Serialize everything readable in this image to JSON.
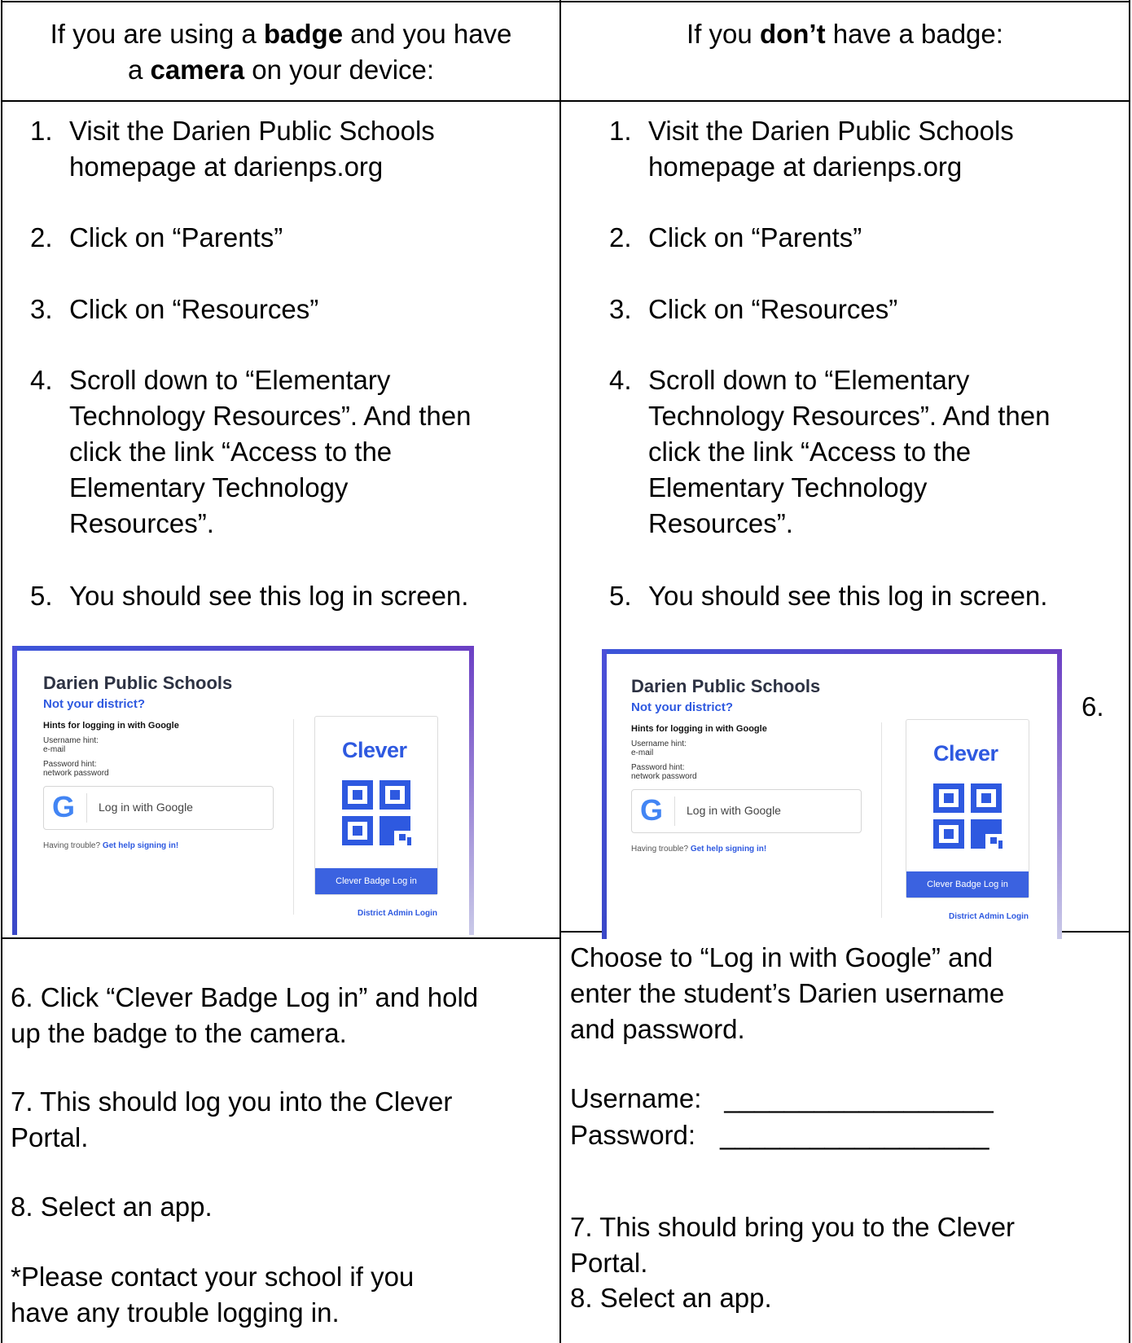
{
  "header": {
    "left": {
      "pre": "If you are using a ",
      "b1": "badge",
      "mid": " and you have",
      "line2_pre": "a ",
      "b2": "camera",
      "line2_post": " on your device:"
    },
    "right": {
      "pre": "If you ",
      "b1": "don’t",
      "post": " have a badge:"
    }
  },
  "left_steps": [
    {
      "num": "1.",
      "lines": [
        " Visit the Darien Public Schools",
        "homepage at darienps.org"
      ]
    },
    {
      "num": "2.",
      "lines": [
        "Click on “Parents”"
      ]
    },
    {
      "num": "3.",
      "lines": [
        "Click on  “Resources”"
      ]
    },
    {
      "num": "4.",
      "lines": [
        "Scroll down to “Elementary",
        "Technology Resources”.  And then",
        "click the link “Access to the",
        "Elementary Technology",
        "Resources”."
      ]
    },
    {
      "num": "5.",
      "lines": [
        "You should see this log in screen."
      ]
    }
  ],
  "right_steps": [
    {
      "num": "1.",
      "lines": [
        "Visit the Darien Public Schools",
        "homepage at darienps.org"
      ]
    },
    {
      "num": "2.",
      "lines": [
        "Click on “Parents”"
      ]
    },
    {
      "num": "3.",
      "lines": [
        "Click on  “Resources”"
      ]
    },
    {
      "num": "4.",
      "lines": [
        "Scroll down to “Elementary",
        "Technology Resources”.  And then",
        "click the link “Access to the",
        "Elementary Technology",
        "Resources”."
      ]
    },
    {
      "num": "5.",
      "lines": [
        "You should see this log in screen."
      ]
    }
  ],
  "login_screen": {
    "district": "Darien Public Schools",
    "not_district": "Not your district?",
    "hints_title": "Hints for logging in with Google",
    "username_hint_label": "Username hint:",
    "username_hint_value": "e-mail",
    "password_hint_label": "Password hint:",
    "password_hint_value": "network password",
    "google_button": "Log in with Google",
    "trouble_text": "Having trouble? ",
    "trouble_link": "Get help signing in!",
    "clever_logo": "Clever",
    "badge_button": "Clever Badge Log in",
    "admin_link": "District Admin Login",
    "colors": {
      "accent": "#2e59e0",
      "button": "#3b62e0",
      "frame": "#4b4fd8"
    }
  },
  "right_six": "6.",
  "left_bottom": [
    [
      "6. Click “Clever Badge Log in” and hold",
      "up the badge to the camera."
    ],
    [
      "7. This should log you into the Clever",
      "Portal."
    ],
    [
      "8. Select an app."
    ],
    [
      "*Please contact your school if you",
      "have any trouble logging in."
    ]
  ],
  "right_bottom": {
    "choose": [
      "Choose to “Log in with Google” and",
      "enter the student’s Darien username",
      "and password."
    ],
    "username_label": "Username:",
    "password_label": "Password:",
    "blank": "__________________",
    "step7": [
      "7. This should bring you to the Clever",
      "Portal."
    ],
    "step8": "8. Select an app."
  }
}
